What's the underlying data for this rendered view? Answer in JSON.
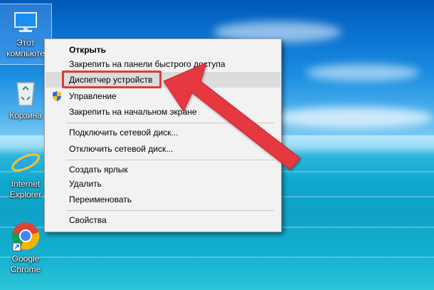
{
  "desktop": {
    "icons": [
      {
        "label_line1": "Этот",
        "label_line2": "компьюте",
        "icon": "computer-icon",
        "selected": true
      },
      {
        "label_line1": "Корзина",
        "icon": "recycle-bin-icon"
      },
      {
        "label_line1": "Internet",
        "label_line2": "Explorer",
        "icon": "internet-explorer-icon"
      },
      {
        "label_line1": "Google",
        "label_line2": "Chrome",
        "icon": "chrome-icon"
      }
    ]
  },
  "context_menu": {
    "items": [
      {
        "label": "Открыть",
        "bold": true
      },
      {
        "label": "Закрепить на панели быстрого доступа"
      },
      {
        "label": "Диспетчер устройств",
        "highlighted": true
      },
      {
        "label": "Управление",
        "icon": "shield-icon"
      },
      {
        "label": "Закрепить на начальном экране"
      },
      {
        "label": "Подключить сетевой диск..."
      },
      {
        "label": "Отключить сетевой диск..."
      },
      {
        "label": "Создать ярлык"
      },
      {
        "label": "Удалить"
      },
      {
        "label": "Переименовать"
      },
      {
        "label": "Свойства"
      }
    ]
  },
  "annotation": {
    "highlight_color": "#e0393e",
    "arrow_color": "#e5393f"
  }
}
